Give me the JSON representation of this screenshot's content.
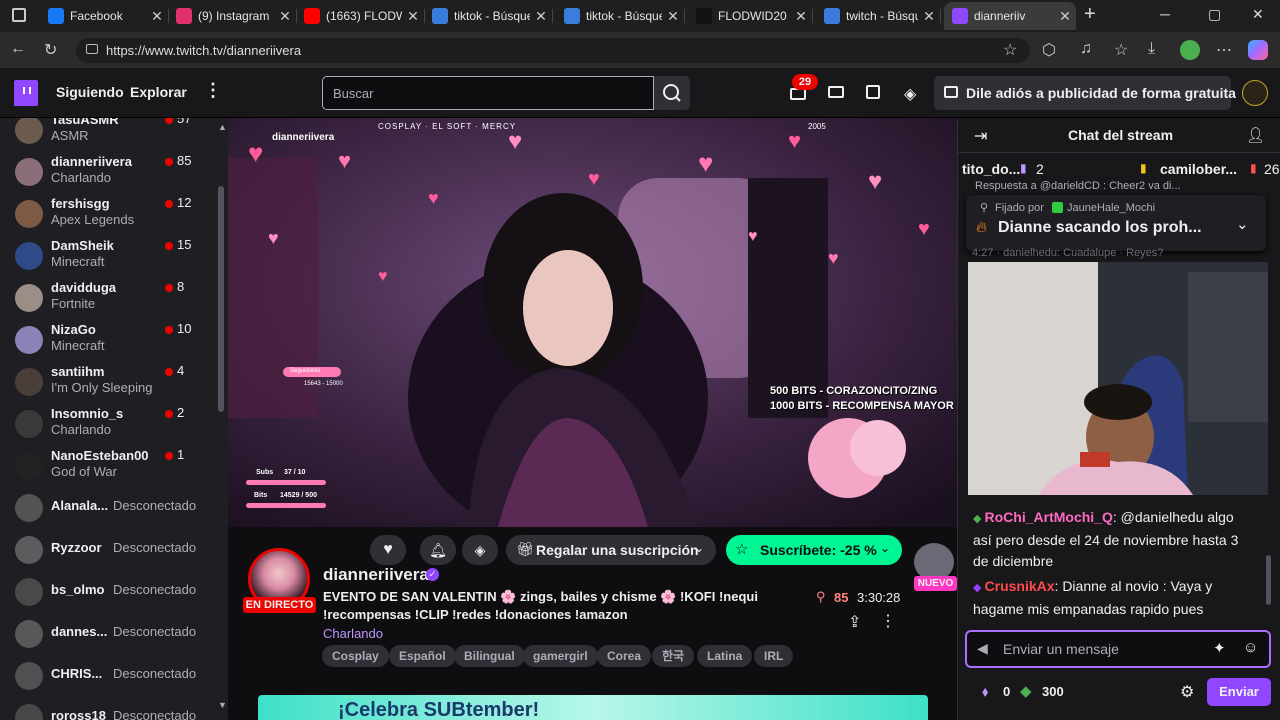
{
  "browser": {
    "tabs": [
      {
        "title": "Facebook",
        "icon": "facebook-icon",
        "color": "#1877f2"
      },
      {
        "title": "(9) Instagram",
        "icon": "instagram-icon",
        "color": "#e1306c"
      },
      {
        "title": "(1663) FLODW",
        "icon": "youtube-icon",
        "color": "#ff0000"
      },
      {
        "title": "tiktok - Búsque",
        "icon": "search-icon",
        "color": "#3b7ddd"
      },
      {
        "title": "tiktok - Búsque",
        "icon": "search-icon",
        "color": "#3b7ddd"
      },
      {
        "title": "FLODWID20 (",
        "icon": "tiktok-icon",
        "color": "#111111"
      },
      {
        "title": "twitch - Búsqu",
        "icon": "search-icon",
        "color": "#3b7ddd"
      },
      {
        "title": "dianneriiv",
        "icon": "twitch-icon",
        "color": "#9147ff"
      }
    ],
    "url": "https://www.twitch.tv/dianneriivera"
  },
  "topnav": {
    "following": "Siguiendo",
    "explore": "Explorar",
    "search_placeholder": "Buscar",
    "notifications_count": "29",
    "promo": "Dile adiós a publicidad de forma gratuita"
  },
  "sidebar": {
    "channels": [
      {
        "name": "TasuASMR",
        "game": "ASMR",
        "viewers": "57",
        "live": true,
        "avatar": "#6b5b4f"
      },
      {
        "name": "dianneriivera",
        "game": "Charlando",
        "viewers": "85",
        "live": true,
        "avatar": "#8a6f7a"
      },
      {
        "name": "fershisgg",
        "game": "Apex Legends",
        "viewers": "12",
        "live": true,
        "avatar": "#7c5a44"
      },
      {
        "name": "DamSheik",
        "game": "Minecraft",
        "viewers": "15",
        "live": true,
        "avatar": "#2e4a88"
      },
      {
        "name": "davidduga",
        "game": "Fortnite",
        "viewers": "8",
        "live": true,
        "avatar": "#9a8e86"
      },
      {
        "name": "NizaGo",
        "game": "Minecraft",
        "viewers": "10",
        "live": true,
        "avatar": "#8d82b8"
      },
      {
        "name": "santiihm",
        "game": "I'm Only Sleeping",
        "viewers": "4",
        "live": true,
        "avatar": "#4a3e38"
      },
      {
        "name": "Insomnio_s",
        "game": "Charlando",
        "viewers": "2",
        "live": true,
        "avatar": "#3a3a3a"
      },
      {
        "name": "NanoEsteban00",
        "game": "God of War",
        "viewers": "1",
        "live": true,
        "avatar": "#222222"
      },
      {
        "name": "Alanala...",
        "status": "Desconectado",
        "live": false,
        "avatar": "#6a6a6a"
      },
      {
        "name": "Ryzzoor",
        "status": "Desconectado",
        "live": false,
        "avatar": "#777777"
      },
      {
        "name": "bs_olmo",
        "status": "Desconectado",
        "live": false,
        "avatar": "#5b5b5b"
      },
      {
        "name": "dannes...",
        "status": "Desconectado",
        "live": false,
        "avatar": "#7a6e6e"
      },
      {
        "name": "CHRIS...",
        "status": "Desconectado",
        "live": false,
        "avatar": "#666666"
      },
      {
        "name": "roross18",
        "status": "Desconectado",
        "live": false,
        "avatar": "#5a5a5a"
      }
    ]
  },
  "video": {
    "overlay_top": "COSPLAY · EL SOFT · MERCY",
    "channel_tag": "dianneriivera",
    "year_tag": "2005",
    "bits_line1": "500 BITS - CORAZONCITO/ZING",
    "bits_line2": "1000 BITS - RECOMPENSA MAYOR",
    "followers_label": "Seguidores",
    "followers_value": "15643 - 15000",
    "subs_label": "Subs",
    "subs_value": "37 / 10",
    "bits_label": "Bits",
    "bits_value": "14529 / 500"
  },
  "stream": {
    "channel": "dianneriivera",
    "live_label": "EN DIRECTO",
    "title_line1": "EVENTO DE SAN VALENTIN 🌸 zings, bailes y chisme 🌸 !KOFI !nequi",
    "title_line2": "!recompensas !CLIP !redes !donaciones !amazon",
    "category": "Charlando",
    "viewers": "85",
    "uptime": "3:30:28",
    "gift_label": "Regalar una suscripción",
    "subscribe_label": "Suscríbete: -25 %",
    "new_label": "NUEVO",
    "tags": [
      "Cosplay",
      "Español",
      "Bilingual",
      "gamergirl",
      "Corea",
      "한국",
      "Latina",
      "IRL"
    ],
    "banner": "¡Celebra SUBtember!"
  },
  "chat": {
    "title": "Chat del stream",
    "gifter1": "tito_do...",
    "gifter1_count": "2",
    "gifter2": "camilober...",
    "gifter2_count": "26",
    "reply_peek": "Respuesta a @darieldCD : Cheer2 va di...",
    "pinned_by_label": "Fijado por",
    "pinned_by": "JauneHale_Mochi",
    "pinned_text": "Dianne sacando los proh...",
    "peek_line": "4:27 · danielhedu: Cuadalupe · Reyes?",
    "messages": [
      {
        "user": "RoChi_ArtMochi_Q",
        "color": "#ff6ac1",
        "text": ": @danielhedu algo así pero desde el 24 de noviembre hasta 3 de diciembre"
      },
      {
        "user": "CrusnikAx",
        "color": "#ff4b4b",
        "text": ": Dianne al novio : Vaya y hagame mis empanadas rapido pues"
      }
    ],
    "input_placeholder": "Enviar un mensaje",
    "points": "0",
    "bits": "300",
    "send_label": "Enviar"
  }
}
